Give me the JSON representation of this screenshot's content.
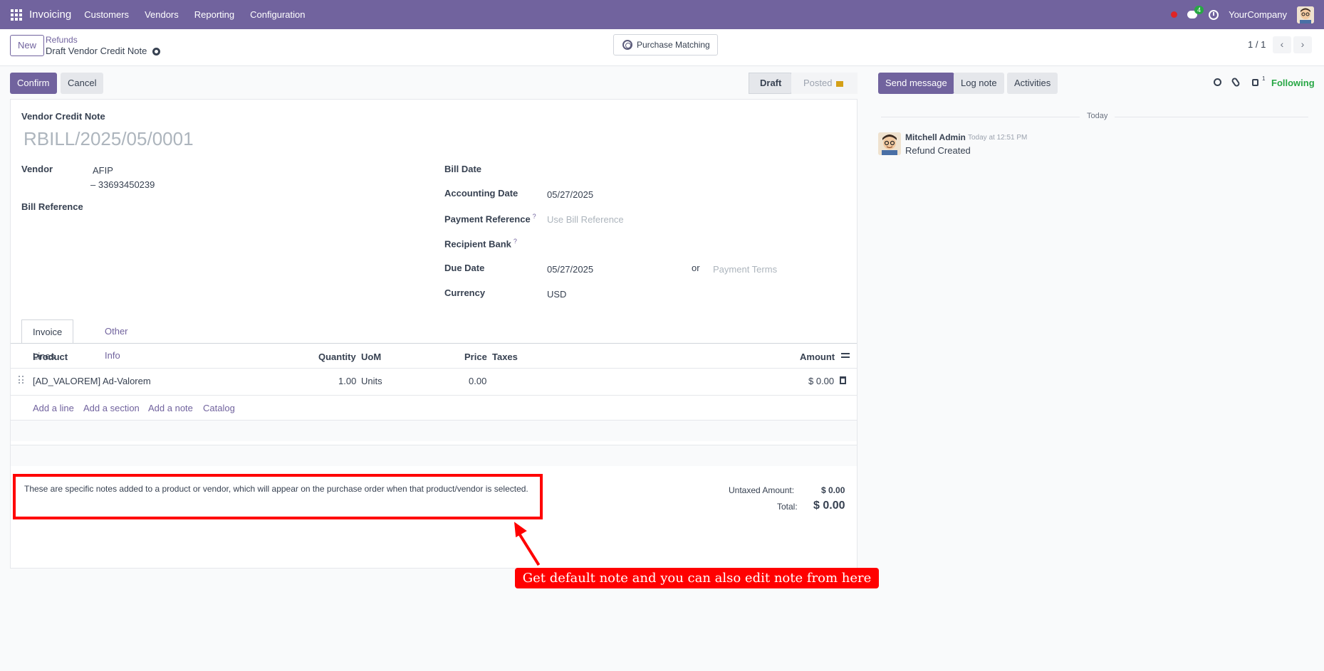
{
  "navbar": {
    "brand": "Invoicing",
    "menu": [
      "Customers",
      "Vendors",
      "Reporting",
      "Configuration"
    ],
    "chat_count": "4",
    "company": "YourCompany"
  },
  "control": {
    "new_label": "New",
    "breadcrumb_parent": "Refunds",
    "breadcrumb_current": "Draft Vendor Credit Note",
    "purchase_matching": "Purchase Matching",
    "pager": "1 / 1"
  },
  "actions": {
    "confirm": "Confirm",
    "cancel": "Cancel",
    "status_draft": "Draft",
    "status_posted": "Posted"
  },
  "form": {
    "doc_type": "Vendor Credit Note",
    "doc_name": "RBILL/2025/05/0001",
    "vendor_label": "Vendor",
    "vendor_name": "AFIP",
    "vendor_vat": "– 33693450239",
    "bill_reference_label": "Bill Reference",
    "bill_date_label": "Bill Date",
    "accounting_date_label": "Accounting Date",
    "accounting_date": "05/27/2025",
    "payment_reference_label": "Payment Reference",
    "payment_reference_placeholder": "Use Bill Reference",
    "recipient_bank_label": "Recipient Bank",
    "due_date_label": "Due Date",
    "due_date": "05/27/2025",
    "or_label": "or",
    "payment_terms_placeholder": "Payment Terms",
    "currency_label": "Currency",
    "currency": "USD",
    "help_mark": "?"
  },
  "tabs": {
    "invoice_lines": "Invoice Lines",
    "other_info": "Other Info"
  },
  "lines": {
    "headers": {
      "product": "Product",
      "quantity": "Quantity",
      "uom": "UoM",
      "price": "Price",
      "taxes": "Taxes",
      "amount": "Amount"
    },
    "rows": [
      {
        "product": "[AD_VALOREM] Ad-Valorem",
        "quantity": "1.00",
        "uom": "Units",
        "price": "0.00",
        "taxes": "",
        "amount": "$ 0.00"
      }
    ],
    "add_line": "Add a line",
    "add_section": "Add a section",
    "add_note": "Add a note",
    "catalog": "Catalog"
  },
  "note": "These are specific notes added to a product or vendor, which will appear on the purchase order when that product/vendor is selected.",
  "totals": {
    "untaxed_label": "Untaxed Amount:",
    "untaxed_value": "$ 0.00",
    "total_label": "Total:",
    "total_value": "$ 0.00"
  },
  "annotation": {
    "callout": "Get default note and you can also edit note from here",
    "color": "#ff0000"
  },
  "chatter": {
    "send_message": "Send message",
    "log_note": "Log note",
    "activities": "Activities",
    "follower_count": "1",
    "following": "Following",
    "today": "Today",
    "message": {
      "author": "Mitchell Admin",
      "time": "Today at 12:51 PM",
      "body": "Refund Created"
    }
  },
  "colors": {
    "brand": "#71639e",
    "following": "#28a745"
  }
}
